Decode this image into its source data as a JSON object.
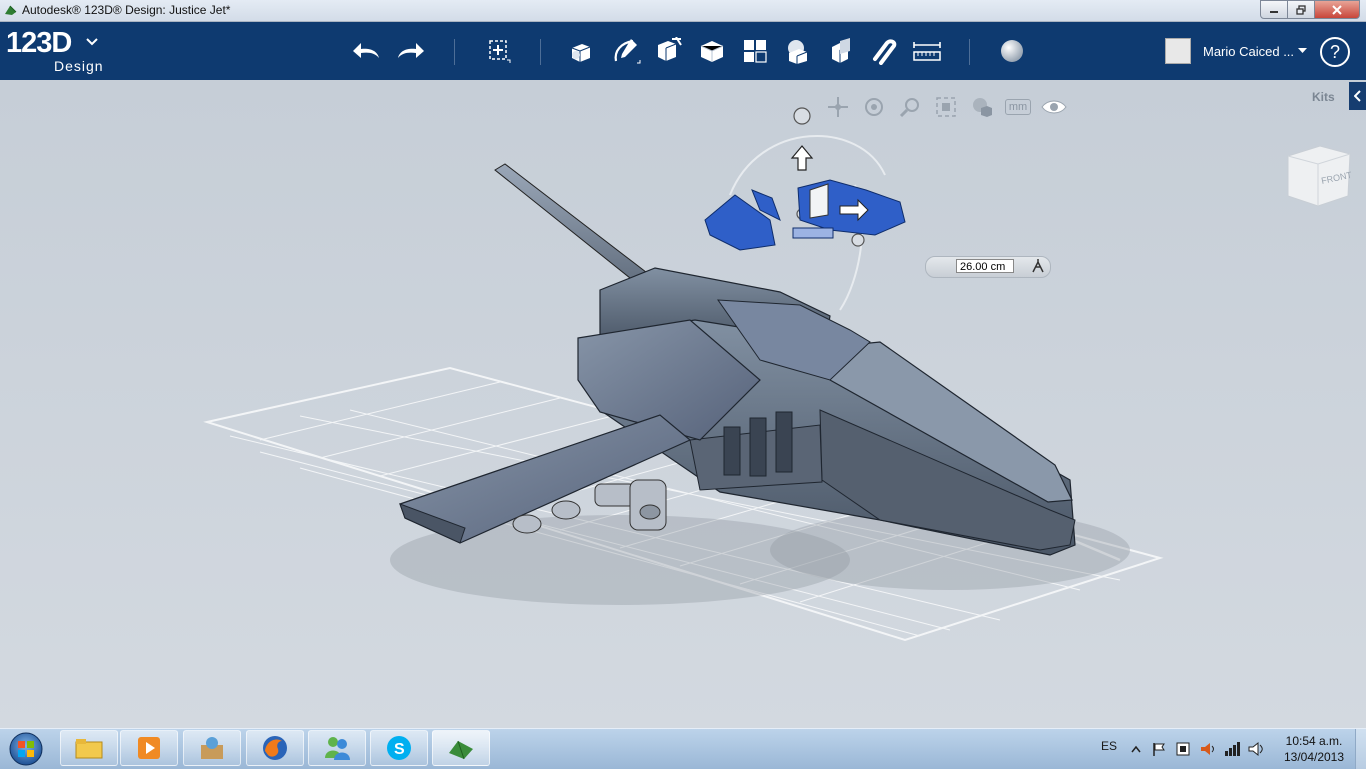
{
  "window": {
    "title": "Autodesk® 123D® Design: Justice Jet*"
  },
  "logo": {
    "main": "123D",
    "sub": "Design"
  },
  "toolbar": {
    "tools": [
      "undo-icon",
      "redo-icon",
      "transform-icon",
      "primitives-icon",
      "sketch-icon",
      "construct-icon",
      "modify-icon",
      "pattern-icon",
      "grouping-icon",
      "combine-icon",
      "snap-icon",
      "measure-icon",
      "material-icon"
    ]
  },
  "user": {
    "name": "Mario Caiced ..."
  },
  "help": {
    "label": "?"
  },
  "viewport": {
    "kits_label": "Kits",
    "units_label": "mm",
    "viewcube_label": "FRONT",
    "dimension_value": "26.00 cm"
  },
  "taskbar": {
    "language": "ES",
    "time": "10:54 a.m.",
    "date": "13/04/2013"
  },
  "colors": {
    "toolbar": "#0e3a70",
    "viewport": "#c9d0d8",
    "model": "#5f6d7e",
    "selection": "#2f5fc8"
  }
}
